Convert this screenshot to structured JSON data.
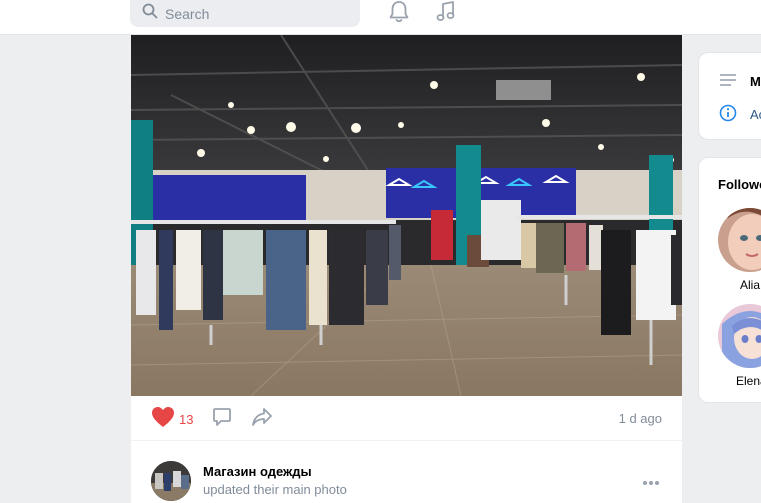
{
  "search": {
    "placeholder": "Search"
  },
  "header": {
    "icons": [
      "bell-icon",
      "music-note-icon"
    ]
  },
  "post": {
    "photo_description_icon": "clothing-store-photo",
    "likes": "13",
    "time": "1 d ago",
    "accent_like": "#e64646"
  },
  "feed_item": {
    "name": "Магазин одежды",
    "action": "updated their main photo"
  },
  "right_menu": {
    "items": [
      {
        "icon": "menu-lines-icon",
        "label": "M"
      },
      {
        "icon": "info-icon",
        "label": "Ac"
      }
    ]
  },
  "followers": {
    "title": "Followe",
    "people": [
      {
        "name": "Alia"
      },
      {
        "name": "Elena"
      }
    ]
  }
}
